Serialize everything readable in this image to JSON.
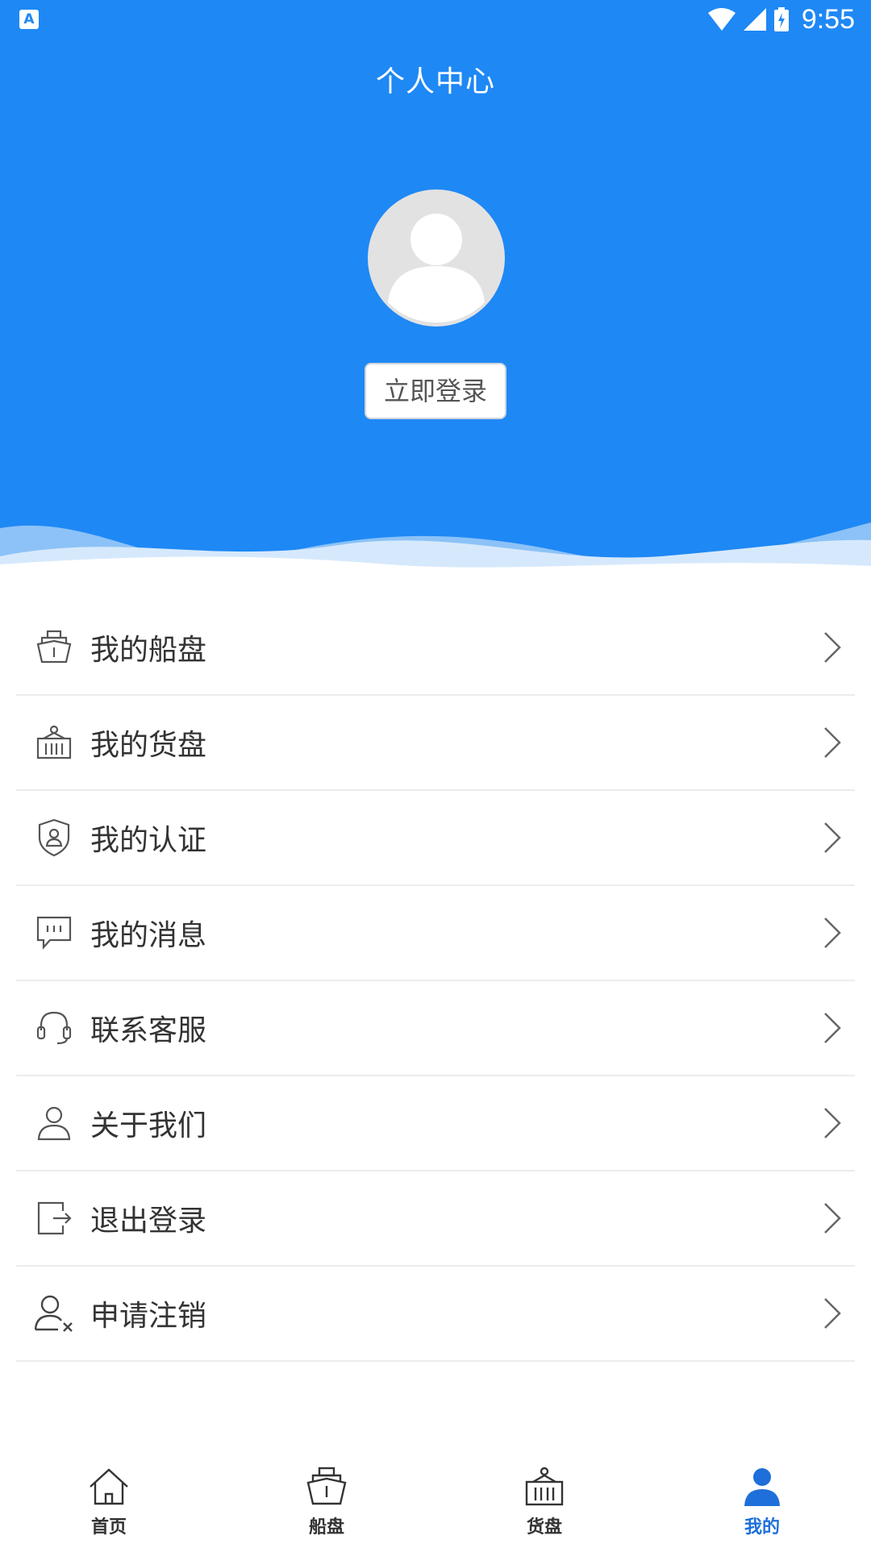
{
  "status_bar": {
    "time": "9:55"
  },
  "header": {
    "title": "个人中心",
    "login_button": "立即登录"
  },
  "menu": [
    {
      "label": "我的船盘",
      "icon": "ship-icon"
    },
    {
      "label": "我的货盘",
      "icon": "cargo-icon"
    },
    {
      "label": "我的认证",
      "icon": "shield-icon"
    },
    {
      "label": "我的消息",
      "icon": "message-icon"
    },
    {
      "label": "联系客服",
      "icon": "headset-icon"
    },
    {
      "label": "关于我们",
      "icon": "user-icon"
    },
    {
      "label": "退出登录",
      "icon": "logout-icon"
    },
    {
      "label": "申请注销",
      "icon": "user-remove-icon"
    }
  ],
  "tabs": [
    {
      "label": "首页",
      "icon": "home-icon",
      "active": false
    },
    {
      "label": "船盘",
      "icon": "ship-icon",
      "active": false
    },
    {
      "label": "货盘",
      "icon": "cargo-icon",
      "active": false
    },
    {
      "label": "我的",
      "icon": "profile-icon",
      "active": true
    }
  ],
  "colors": {
    "primary": "#1e88f5",
    "active_tab": "#1e6fd9",
    "text": "#333333"
  }
}
